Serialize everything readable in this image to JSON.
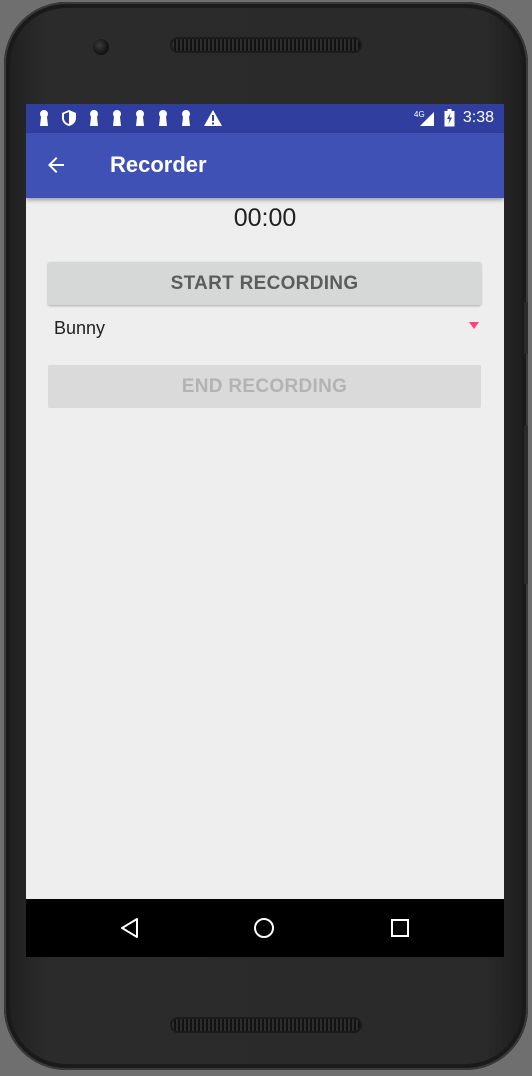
{
  "status_bar": {
    "time": "3:38",
    "network": "4G",
    "icons_left": [
      "keyhole-icon",
      "shield-icon",
      "keyhole-icon",
      "keyhole-icon",
      "keyhole-icon",
      "keyhole-icon",
      "keyhole-icon",
      "warning-icon"
    ],
    "background": "#303f9f"
  },
  "app_bar": {
    "title": "Recorder",
    "back_icon": "arrow-back-icon",
    "background": "#3f51b5"
  },
  "main": {
    "timer": "00:00",
    "start_button_label": "START RECORDING",
    "spinner_selected": "Bunny",
    "end_button_label": "END RECORDING",
    "end_button_enabled": false,
    "accent": "#ff4081"
  },
  "nav_bar": {
    "back": "nav-back-icon",
    "home": "nav-home-icon",
    "recents": "nav-recents-icon"
  }
}
